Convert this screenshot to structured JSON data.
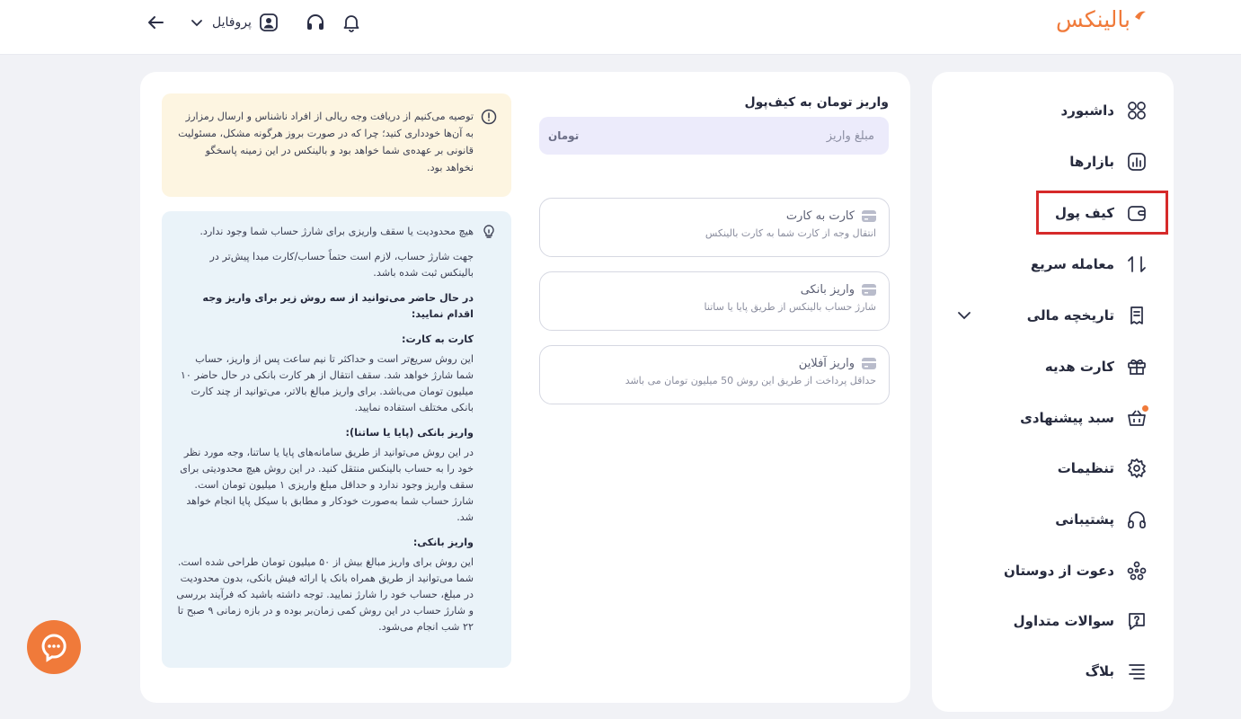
{
  "brand": {
    "logo_text": "بالینکس",
    "accent": "#f07a3a"
  },
  "header": {
    "profile_label": "پروفایل"
  },
  "sidebar": {
    "items": [
      {
        "label": "داشبورد",
        "icon": "dashboard-icon"
      },
      {
        "label": "بازارها",
        "icon": "markets-icon"
      },
      {
        "label": "کیف پول",
        "icon": "wallet-icon",
        "active": true
      },
      {
        "label": "معامله سریع",
        "icon": "swap-arrows-icon"
      },
      {
        "label": "تاریخچه مالی",
        "icon": "receipt-icon",
        "expandable": true
      },
      {
        "label": "کارت هدیه",
        "icon": "gift-icon"
      },
      {
        "label": "سبد پیشنهادی",
        "icon": "basket-icon",
        "badge_dot": true
      },
      {
        "label": "تنظیمات",
        "icon": "gear-icon"
      },
      {
        "label": "پشتیبانی",
        "icon": "headset-icon"
      },
      {
        "label": "دعوت از دوستان",
        "icon": "people-icon"
      },
      {
        "label": "سوالات متداول",
        "icon": "question-bubble-icon"
      },
      {
        "label": "بلاگ",
        "icon": "blog-lines-icon"
      }
    ],
    "highlight_color": "#d62a2a"
  },
  "deposit": {
    "title": "واریز تومان به کیف‌پول",
    "amount_placeholder": "مبلغ واریز",
    "currency_icon": "تومان",
    "methods": [
      {
        "title": "کارت به کارت",
        "desc": "انتقال وجه از کارت شما به کارت بالینکس"
      },
      {
        "title": "واریز بانکی",
        "desc": "شارژ حساب بالینکس از طریق پایا یا ساتنا"
      },
      {
        "title": "واریز آفلاین",
        "desc": "حداقل پرداخت از طریق این روش 50 میلیون تومان می باشد"
      }
    ]
  },
  "warning": {
    "text": "توصیه می‌کنیم از دریافت وجه ریالی از افراد ناشناس و ارسال رمزارز به آن‌ها خودداری کنید؛ چرا که در صورت بروز هرگونه مشکل، مسئولیت قانونی بر عهده‌ی شما خواهد بود و بالینکس در این زمینه پاسخگو نخواهد بود."
  },
  "info": {
    "p1": "هیچ محدودیت یا سقف واریزی برای شارژ حساب شما وجود ندارد.",
    "p2": "جهت شارژ حساب، لازم است حتماً حساب/کارت مبدا پیش‌تر در بالینکس ثبت شده باشد.",
    "p3": "در حال حاضر می‌توانید از سه روش زیر برای واریز وجه اقدام نمایید:",
    "h1": "کارت به کارت:",
    "t1": "این روش سریع‌تر است و حداکثر تا نیم ساعت پس از واریز، حساب شما شارژ خواهد شد. سقف انتقال از هر کارت بانکی در حال حاضر ۱۰ میلیون تومان می‌باشد. برای واریز مبالغ بالاتر، می‌توانید از چند کارت بانکی مختلف استفاده نمایید.",
    "h2": "واریز بانکی (پایا یا ساتنا):",
    "t2": "در این روش می‌توانید از طریق سامانه‌های پایا یا ساتنا، وجه مورد نظر خود را به حساب بالینکس منتقل کنید. در این روش هیچ محدودیتی برای سقف واریز وجود ندارد و حداقل مبلغ واریزی ۱ میلیون تومان است. شارژ حساب شما به‌صورت خودکار و مطابق با سیکل پایا انجام خواهد شد.",
    "h3": "واریز بانکی:",
    "t3": "این روش برای واریز مبالغ بیش از ۵۰ میلیون تومان طراحی شده است. شما می‌توانید از طریق همراه بانک یا ارائه فیش بانکی، بدون محدودیت در مبلغ، حساب خود را شارژ نمایید. توجه داشته باشید که فرآیند بررسی و شارژ حساب در این روش کمی زمان‌بر بوده و در بازه زمانی ۹ صبح تا ۲۲ شب انجام می‌شود."
  }
}
